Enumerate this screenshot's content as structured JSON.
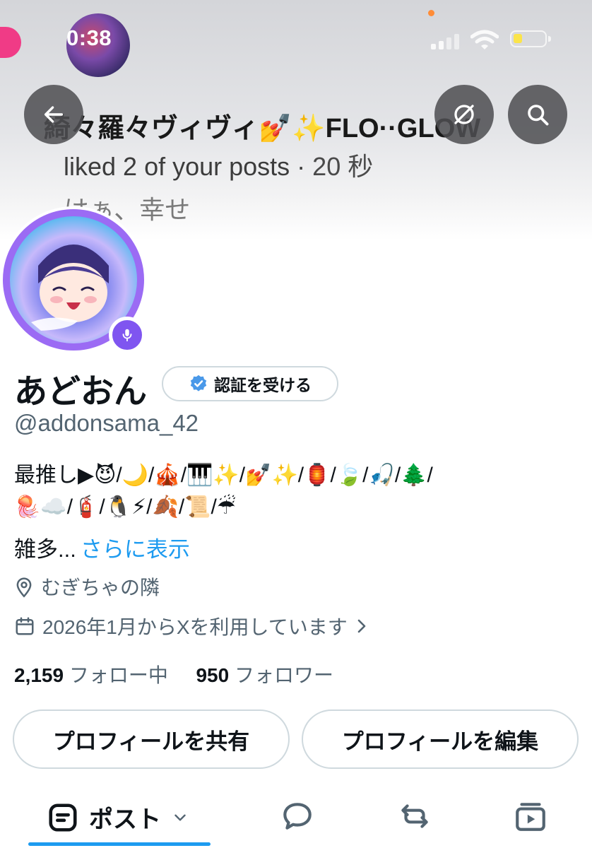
{
  "status_bar": {
    "time": "0:38"
  },
  "header": {
    "notification_title": "綺々羅々ヴィヴィ💅✨FLO··GLOW",
    "notification_body": "liked 2 of your posts · ",
    "notification_time": "20 秒",
    "notification_extra": "はぁ、幸せ",
    "back_icon": "arrow-left-icon",
    "grok_icon": "slash-circle-icon",
    "search_icon": "search-icon"
  },
  "profile": {
    "display_name": "あどおん",
    "verify_label": "認証を受ける",
    "handle": "@addonsama_42",
    "bio_line1": "最推し▶😈/🌙/🎪/🎹✨/💅✨/🏮/🍃/🎣/🌲/",
    "bio_line2": "🪼☁️/🧯/🐧⚡/🍂/📜/☔",
    "bio_more_text": "雑多...",
    "bio_more_link": "さらに表示",
    "location": "むぎちゃの隣",
    "joined": "2026年1月からXを利用しています",
    "following_count": "2,159",
    "following_label": "フォロー中",
    "followers_count": "950",
    "followers_label": "フォロワー"
  },
  "actions": {
    "share_label": "プロフィールを共有",
    "edit_label": "プロフィールを編集"
  },
  "tabs": {
    "posts_label": "ポスト"
  },
  "colors": {
    "accent": "#1d9bf0",
    "verified_badge": "#4a99e9",
    "avatar_ring": "#9b6bf4"
  }
}
